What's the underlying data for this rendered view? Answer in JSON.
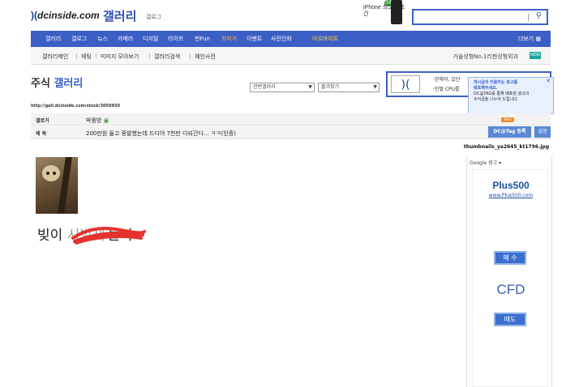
{
  "header": {
    "logo_text": "dcinside.com",
    "brand": "갤러리",
    "brand_sub": "갤로그",
    "phone_ad": "iPhone 최고의 조건"
  },
  "nav": {
    "items": [
      "갤러리",
      "갤로그",
      "뉴스",
      "카메라",
      "디지털",
      "라이프",
      "펀Fun",
      "최저가",
      "이벤트",
      "사진인화",
      "아르바이트"
    ],
    "more": "더보기"
  },
  "subnav": {
    "items": [
      "갤러리메인",
      "웨팅",
      "미미지 모아보기",
      "갤러리검색",
      "혜인사전"
    ],
    "right": "가솔성형No.1리젠성형외과"
  },
  "gallery": {
    "title_plain": "주식",
    "title_accent": "갤러리",
    "select1": "관련갤러리",
    "select2": "즐겨찾기",
    "url": "http://gall.dcinside.com/stock/3050950"
  },
  "ad": {
    "line1": "·한해야, 있던",
    "line2": "·인텔 CPU를"
  },
  "tooltip": {
    "line1": "게시글과 어울리는 광고를",
    "line2": "배포해주세요.",
    "line3": "DC@TAG를 통해 배포된 광고의",
    "line4": "수익금을 나누어 드립니다."
  },
  "post": {
    "gallogger_label": "갤로거",
    "gallogger_value": "박몽방",
    "subject_label": "제 목",
    "subject_value": "200만원 들고 종발했는데 드디어 7천만 다되간다... ㅋㅋ(인증)",
    "dcotag_label": "DC@Tag 등록",
    "small_btn": "설정",
    "filename": "thumbnails_ya2645_kt1796.jpg",
    "body_text": "빚이 "
  },
  "google_ad": {
    "label": "Google 광고",
    "brand": "Plus500",
    "url": "www.Plus500.com",
    "buy": "매 수",
    "product": "CFD",
    "sell": "매도"
  }
}
